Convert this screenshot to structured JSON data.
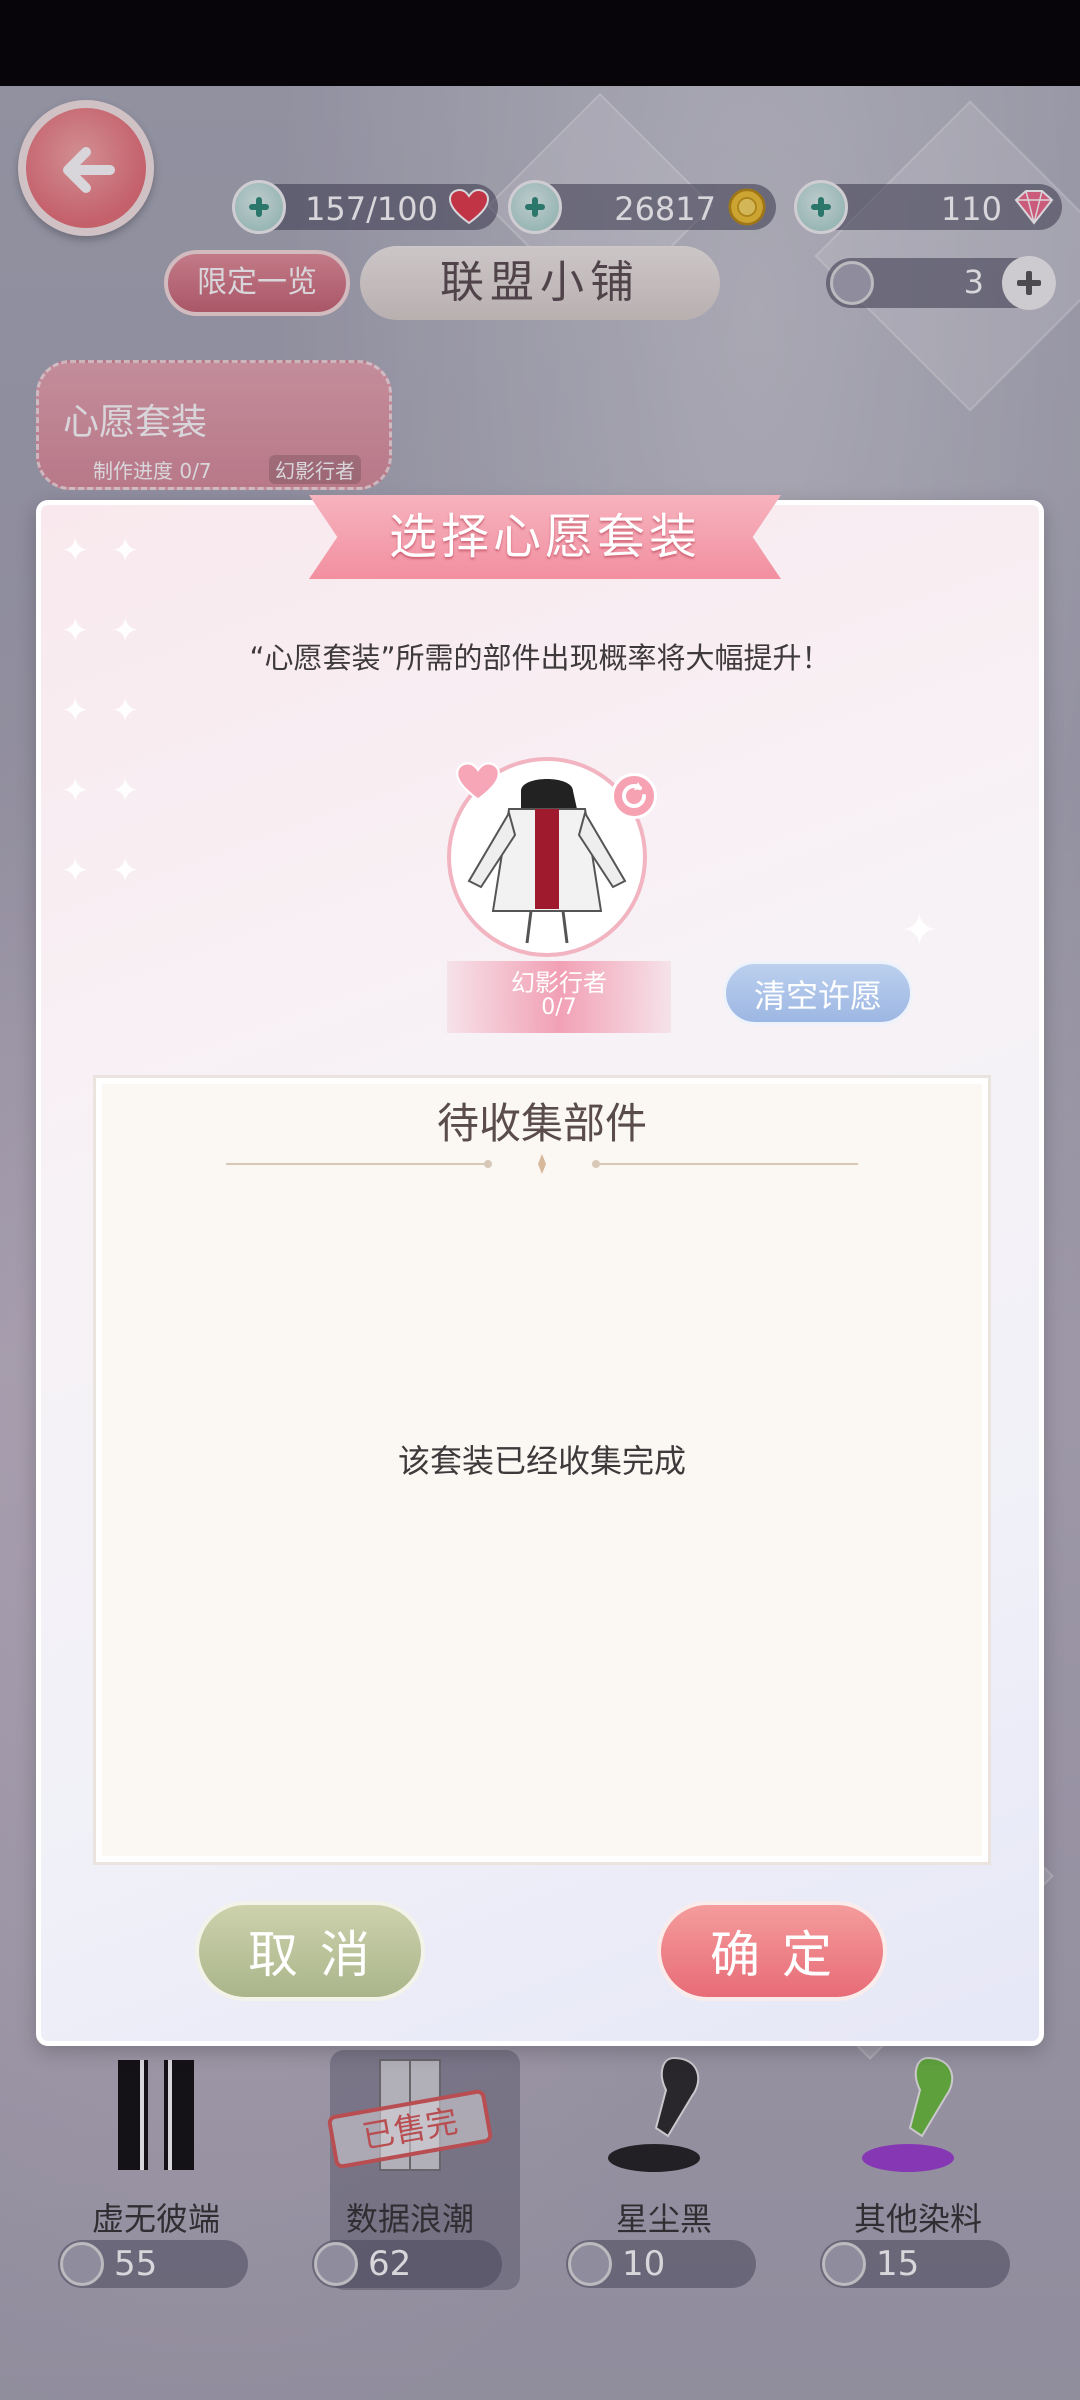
{
  "resources": {
    "stamina": "157/100",
    "gold": "26817",
    "diamond": "110"
  },
  "header": {
    "limited_label": "限定一览",
    "shop_title": "联盟小铺",
    "token_count": "3"
  },
  "wish_chip": {
    "title": "心愿套装",
    "progress": "制作进度 0/7",
    "suit_name": "幻影行者"
  },
  "modal": {
    "title": "选择心愿套装",
    "subtitle": "“心愿套装”所需的部件出现概率将大幅提升！",
    "suit_name": "幻影行者",
    "suit_progress": "0/7",
    "clear_label": "清空许愿",
    "panel_title": "待收集部件",
    "empty_text": "该套装已经收集完成",
    "cancel_label": "取消",
    "confirm_label": "确定"
  },
  "shop_items": [
    {
      "name": "虚无彼端",
      "price": "55"
    },
    {
      "name": "数据浪潮",
      "price": "62",
      "badge": "已售完"
    },
    {
      "name": "星尘黑",
      "price": "10"
    },
    {
      "name": "其他染料",
      "price": "15"
    }
  ],
  "colors": {
    "accent_pink": "#e86c78",
    "cancel_green": "#aab58a",
    "clear_blue": "#9db7e3"
  },
  "icons": {
    "back": "arrow-left-icon",
    "heart": "heart-icon",
    "gold": "coin-icon",
    "diamond": "gem-icon",
    "refresh": "refresh-icon"
  }
}
